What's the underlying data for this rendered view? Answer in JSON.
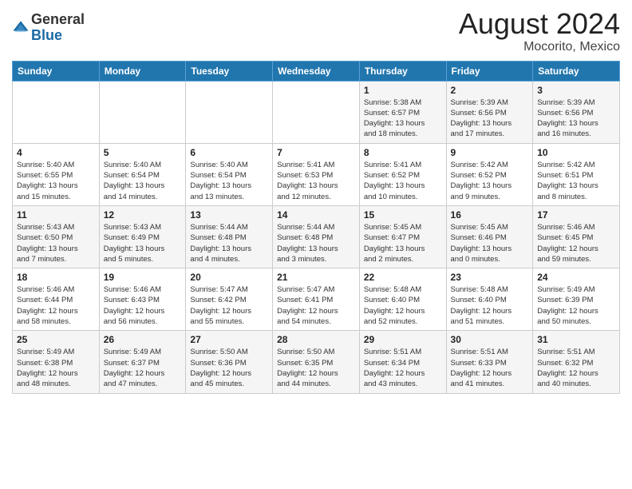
{
  "header": {
    "logo_general": "General",
    "logo_blue": "Blue",
    "month_year": "August 2024",
    "location": "Mocorito, Mexico"
  },
  "weekdays": [
    "Sunday",
    "Monday",
    "Tuesday",
    "Wednesday",
    "Thursday",
    "Friday",
    "Saturday"
  ],
  "weeks": [
    [
      {
        "day": "",
        "info": ""
      },
      {
        "day": "",
        "info": ""
      },
      {
        "day": "",
        "info": ""
      },
      {
        "day": "",
        "info": ""
      },
      {
        "day": "1",
        "info": "Sunrise: 5:38 AM\nSunset: 6:57 PM\nDaylight: 13 hours\nand 18 minutes."
      },
      {
        "day": "2",
        "info": "Sunrise: 5:39 AM\nSunset: 6:56 PM\nDaylight: 13 hours\nand 17 minutes."
      },
      {
        "day": "3",
        "info": "Sunrise: 5:39 AM\nSunset: 6:56 PM\nDaylight: 13 hours\nand 16 minutes."
      }
    ],
    [
      {
        "day": "4",
        "info": "Sunrise: 5:40 AM\nSunset: 6:55 PM\nDaylight: 13 hours\nand 15 minutes."
      },
      {
        "day": "5",
        "info": "Sunrise: 5:40 AM\nSunset: 6:54 PM\nDaylight: 13 hours\nand 14 minutes."
      },
      {
        "day": "6",
        "info": "Sunrise: 5:40 AM\nSunset: 6:54 PM\nDaylight: 13 hours\nand 13 minutes."
      },
      {
        "day": "7",
        "info": "Sunrise: 5:41 AM\nSunset: 6:53 PM\nDaylight: 13 hours\nand 12 minutes."
      },
      {
        "day": "8",
        "info": "Sunrise: 5:41 AM\nSunset: 6:52 PM\nDaylight: 13 hours\nand 10 minutes."
      },
      {
        "day": "9",
        "info": "Sunrise: 5:42 AM\nSunset: 6:52 PM\nDaylight: 13 hours\nand 9 minutes."
      },
      {
        "day": "10",
        "info": "Sunrise: 5:42 AM\nSunset: 6:51 PM\nDaylight: 13 hours\nand 8 minutes."
      }
    ],
    [
      {
        "day": "11",
        "info": "Sunrise: 5:43 AM\nSunset: 6:50 PM\nDaylight: 13 hours\nand 7 minutes."
      },
      {
        "day": "12",
        "info": "Sunrise: 5:43 AM\nSunset: 6:49 PM\nDaylight: 13 hours\nand 5 minutes."
      },
      {
        "day": "13",
        "info": "Sunrise: 5:44 AM\nSunset: 6:48 PM\nDaylight: 13 hours\nand 4 minutes."
      },
      {
        "day": "14",
        "info": "Sunrise: 5:44 AM\nSunset: 6:48 PM\nDaylight: 13 hours\nand 3 minutes."
      },
      {
        "day": "15",
        "info": "Sunrise: 5:45 AM\nSunset: 6:47 PM\nDaylight: 13 hours\nand 2 minutes."
      },
      {
        "day": "16",
        "info": "Sunrise: 5:45 AM\nSunset: 6:46 PM\nDaylight: 13 hours\nand 0 minutes."
      },
      {
        "day": "17",
        "info": "Sunrise: 5:46 AM\nSunset: 6:45 PM\nDaylight: 12 hours\nand 59 minutes."
      }
    ],
    [
      {
        "day": "18",
        "info": "Sunrise: 5:46 AM\nSunset: 6:44 PM\nDaylight: 12 hours\nand 58 minutes."
      },
      {
        "day": "19",
        "info": "Sunrise: 5:46 AM\nSunset: 6:43 PM\nDaylight: 12 hours\nand 56 minutes."
      },
      {
        "day": "20",
        "info": "Sunrise: 5:47 AM\nSunset: 6:42 PM\nDaylight: 12 hours\nand 55 minutes."
      },
      {
        "day": "21",
        "info": "Sunrise: 5:47 AM\nSunset: 6:41 PM\nDaylight: 12 hours\nand 54 minutes."
      },
      {
        "day": "22",
        "info": "Sunrise: 5:48 AM\nSunset: 6:40 PM\nDaylight: 12 hours\nand 52 minutes."
      },
      {
        "day": "23",
        "info": "Sunrise: 5:48 AM\nSunset: 6:40 PM\nDaylight: 12 hours\nand 51 minutes."
      },
      {
        "day": "24",
        "info": "Sunrise: 5:49 AM\nSunset: 6:39 PM\nDaylight: 12 hours\nand 50 minutes."
      }
    ],
    [
      {
        "day": "25",
        "info": "Sunrise: 5:49 AM\nSunset: 6:38 PM\nDaylight: 12 hours\nand 48 minutes."
      },
      {
        "day": "26",
        "info": "Sunrise: 5:49 AM\nSunset: 6:37 PM\nDaylight: 12 hours\nand 47 minutes."
      },
      {
        "day": "27",
        "info": "Sunrise: 5:50 AM\nSunset: 6:36 PM\nDaylight: 12 hours\nand 45 minutes."
      },
      {
        "day": "28",
        "info": "Sunrise: 5:50 AM\nSunset: 6:35 PM\nDaylight: 12 hours\nand 44 minutes."
      },
      {
        "day": "29",
        "info": "Sunrise: 5:51 AM\nSunset: 6:34 PM\nDaylight: 12 hours\nand 43 minutes."
      },
      {
        "day": "30",
        "info": "Sunrise: 5:51 AM\nSunset: 6:33 PM\nDaylight: 12 hours\nand 41 minutes."
      },
      {
        "day": "31",
        "info": "Sunrise: 5:51 AM\nSunset: 6:32 PM\nDaylight: 12 hours\nand 40 minutes."
      }
    ]
  ]
}
